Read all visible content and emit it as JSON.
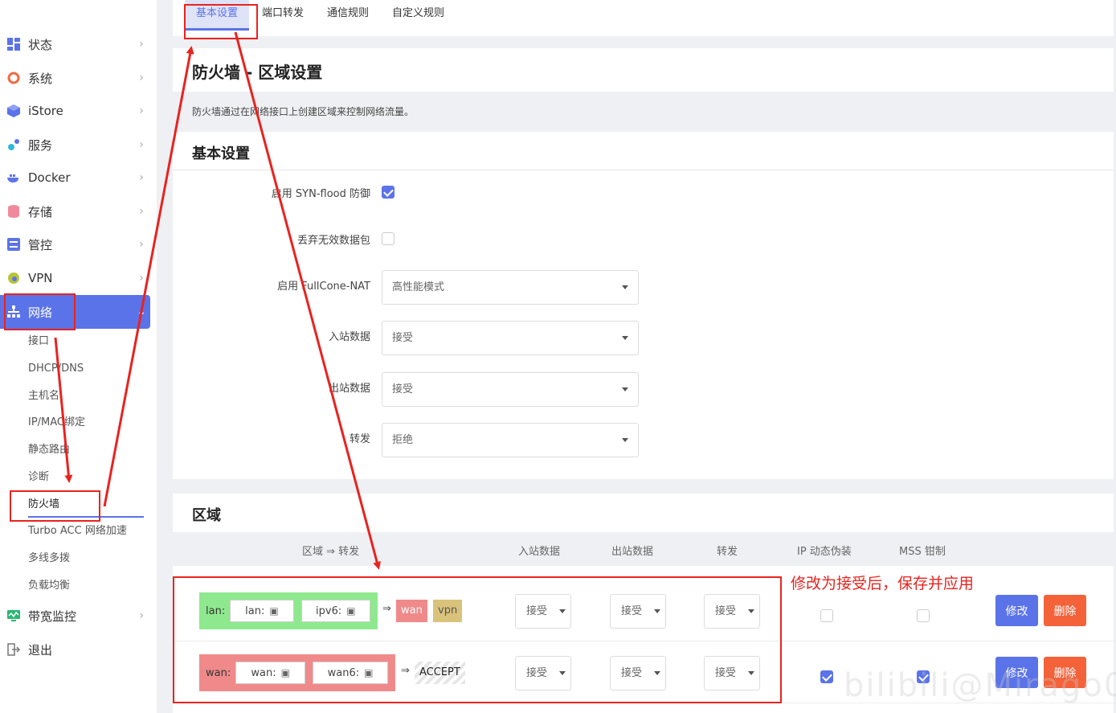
{
  "sidebar": {
    "items": [
      {
        "label": "状态",
        "icon": "dashboard-icon",
        "color": "#5b73e8"
      },
      {
        "label": "系统",
        "icon": "gear-icon",
        "color": "#f06a45"
      },
      {
        "label": "iStore",
        "icon": "cube-icon",
        "color": "#5b73e8"
      },
      {
        "label": "服务",
        "icon": "gears-icon",
        "color": "#34b9d8"
      },
      {
        "label": "Docker",
        "icon": "docker-icon",
        "color": "#5b73e8"
      },
      {
        "label": "存储",
        "icon": "database-icon",
        "color": "#f08a9a"
      },
      {
        "label": "管控",
        "icon": "sliders-icon",
        "color": "#5b73e8"
      },
      {
        "label": "VPN",
        "icon": "globe-icon",
        "color": "#b7c534"
      },
      {
        "label": "网络",
        "icon": "network-icon",
        "color": "#ffffff"
      },
      {
        "label": "带宽监控",
        "icon": "monitor-icon",
        "color": "#2bb673"
      },
      {
        "label": "退出",
        "icon": "logout-icon",
        "color": "#777777"
      }
    ],
    "network_sub": [
      "接口",
      "DHCP/DNS",
      "主机名",
      "IP/MAC绑定",
      "静态路由",
      "诊断",
      "防火墙",
      "Turbo ACC 网络加速",
      "多线多拨",
      "负载均衡"
    ]
  },
  "tabs": [
    "基本设置",
    "端口转发",
    "通信规则",
    "自定义规则"
  ],
  "page": {
    "title": "防火墙 - 区域设置",
    "description": "防火墙通过在网络接口上创建区域来控制网络流量。"
  },
  "basic": {
    "title": "基本设置",
    "syn_label": "启用 SYN-flood 防御",
    "drop_label": "丢弃无效数据包",
    "fullcone_label": "启用 FullCone-NAT",
    "fullcone_value": "高性能模式",
    "input_label": "入站数据",
    "input_value": "接受",
    "output_label": "出站数据",
    "output_value": "接受",
    "forward_label": "转发",
    "forward_value": "拒绝"
  },
  "zones": {
    "title": "区域",
    "headers": [
      "区域 ⇒ 转发",
      "入站数据",
      "出站数据",
      "转发",
      "IP 动态伪装",
      "MSS 钳制"
    ],
    "rows": [
      {
        "name": "lan:",
        "ifaces": [
          "lan:",
          "ipv6:"
        ],
        "arrow": "⇒",
        "targets": [
          "wan",
          "vpn"
        ],
        "input": "接受",
        "output": "接受",
        "forward": "接受",
        "masq": false,
        "mss": false,
        "color": "#8ee98e"
      },
      {
        "name": "wan:",
        "ifaces": [
          "wan:",
          "wan6:"
        ],
        "arrow": "⇒",
        "targets": [
          "ACCEPT"
        ],
        "input": "接受",
        "output": "接受",
        "forward": "接受",
        "masq": true,
        "mss": true,
        "color": "#f08a8a"
      }
    ],
    "edit_label": "修改",
    "delete_label": "删除"
  },
  "annotation": {
    "note": "修改为接受后，保存并应用",
    "color": "#e8231f"
  },
  "watermark": "bilibili@Mirago0"
}
